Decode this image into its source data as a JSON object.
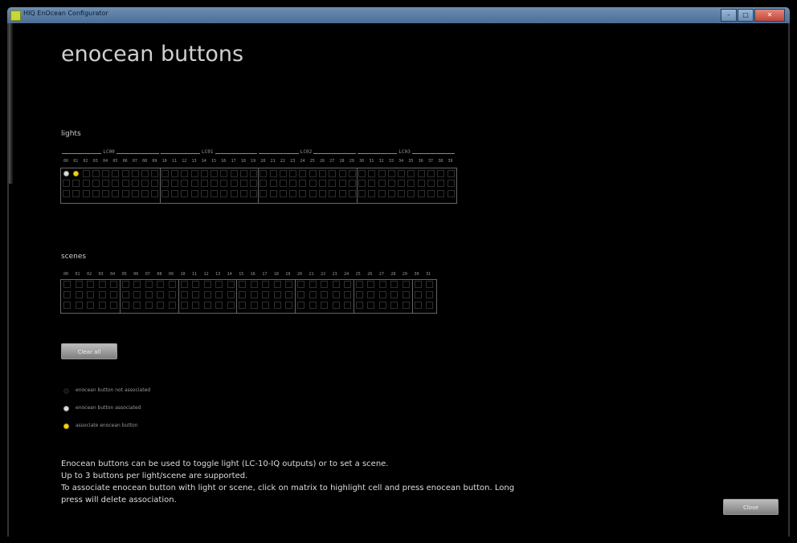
{
  "window": {
    "title": "HIQ EnOcean Configurator",
    "controls": [
      "–",
      "□",
      "✕"
    ]
  },
  "page_title": "enocean buttons",
  "lights": {
    "label": "lights",
    "groups": [
      "LC00",
      "LC01",
      "LC02",
      "LC03"
    ],
    "indices": [
      "00",
      "01",
      "02",
      "03",
      "04",
      "05",
      "06",
      "07",
      "08",
      "09",
      "10",
      "11",
      "12",
      "13",
      "14",
      "15",
      "16",
      "17",
      "18",
      "19",
      "20",
      "21",
      "22",
      "23",
      "24",
      "25",
      "26",
      "27",
      "28",
      "29",
      "30",
      "31",
      "32",
      "33",
      "34",
      "35",
      "36",
      "37",
      "38",
      "39"
    ],
    "rows": 3,
    "cells": [
      {
        "row": 0,
        "col": 0,
        "state": "associated"
      },
      {
        "row": 0,
        "col": 1,
        "state": "associate"
      }
    ]
  },
  "scenes": {
    "label": "scenes",
    "indices": [
      "00",
      "01",
      "02",
      "03",
      "04",
      "05",
      "06",
      "07",
      "08",
      "09",
      "10",
      "11",
      "12",
      "13",
      "14",
      "15",
      "16",
      "17",
      "18",
      "19",
      "20",
      "21",
      "22",
      "23",
      "24",
      "25",
      "26",
      "27",
      "28",
      "29",
      "30",
      "31"
    ],
    "rows": 3,
    "cells": []
  },
  "clear_all_label": "Clear all",
  "legend": [
    {
      "state": "not_associated",
      "text": "enocean button not associated"
    },
    {
      "state": "associated",
      "text": "enocean button associated"
    },
    {
      "state": "associate",
      "text": "associate enocean button"
    }
  ],
  "help": [
    "Enocean buttons can be used to toggle light (LC-10-IQ outputs) or to set a scene.",
    "Up to 3 buttons per light/scene are supported.",
    "To associate enocean button with light or scene, click on matrix to highlight cell and press enocean button. Long",
    "press will delete association."
  ],
  "close_label": "Close",
  "colors": {
    "associated": "#dddddd",
    "associate": "#f2d21a",
    "background": "#000000"
  }
}
